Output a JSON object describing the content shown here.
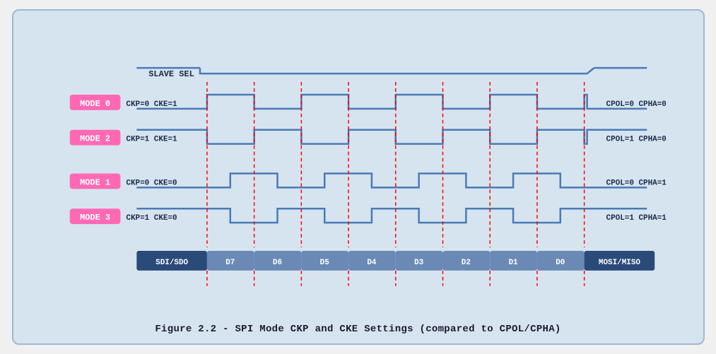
{
  "caption": "Figure 2.2 - SPI Mode CKP and CKE Settings (compared to CPOL/CPHA)",
  "diagram": {
    "slave_sel_label": "SLAVE SEL",
    "mode0_label": "MODE 0",
    "mode0_params": "CKP=0  CKE=1",
    "mode0_right": "CPOL=0  CPHA=0",
    "mode2_label": "MODE 2",
    "mode2_params": "CKP=1  CKE=1",
    "mode2_right": "CPOL=1  CPHA=0",
    "mode1_label": "MODE 1",
    "mode1_params": "CKP=0  CKE=0",
    "mode1_right": "CPOL=0  CPHA=1",
    "mode3_label": "MODE 3",
    "mode3_params": "CKP=1  CKE=0",
    "mode3_right": "CPOL=1  CPHA=1",
    "data_bits": [
      "SDI/SDO",
      "D7",
      "D6",
      "D5",
      "D4",
      "D3",
      "D2",
      "D1",
      "D0",
      "MOSI/MISO"
    ]
  }
}
